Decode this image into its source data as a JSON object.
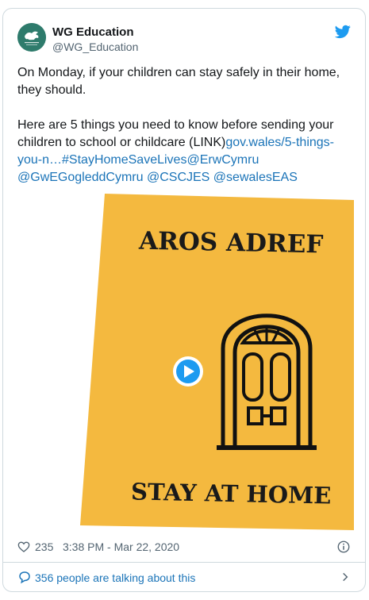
{
  "tweet": {
    "display_name": "WG Education",
    "handle": "@WG_Education",
    "text_line1": "On Monday, if your children can stay safely in their home, they should.",
    "text_line2_prefix": "Here are 5 things you need to know before sending your children to school or childcare (LINK)",
    "link_url": "gov.wales/5-things-you-n…",
    "hashtag": "#StayHomeSaveLives",
    "mentions": [
      "@ErwCymru",
      "@GwEGogleddCymru",
      "@CSCJES",
      "@sewalesEAS"
    ]
  },
  "media": {
    "heading_cy": "AROS ADREF",
    "heading_en": "STAY AT HOME",
    "background_color": "#f4b93f",
    "play_button_color": "#1d9bf0"
  },
  "footer": {
    "likes": "235",
    "timestamp": "3:38 PM - Mar 22, 2020",
    "conversation_label": "356 people are talking about this"
  },
  "icons": {
    "brand": "twitter-bird-icon",
    "like": "heart-icon",
    "info": "info-icon",
    "conversation": "speech-bubble-icon",
    "next": "chevron-right-icon"
  }
}
